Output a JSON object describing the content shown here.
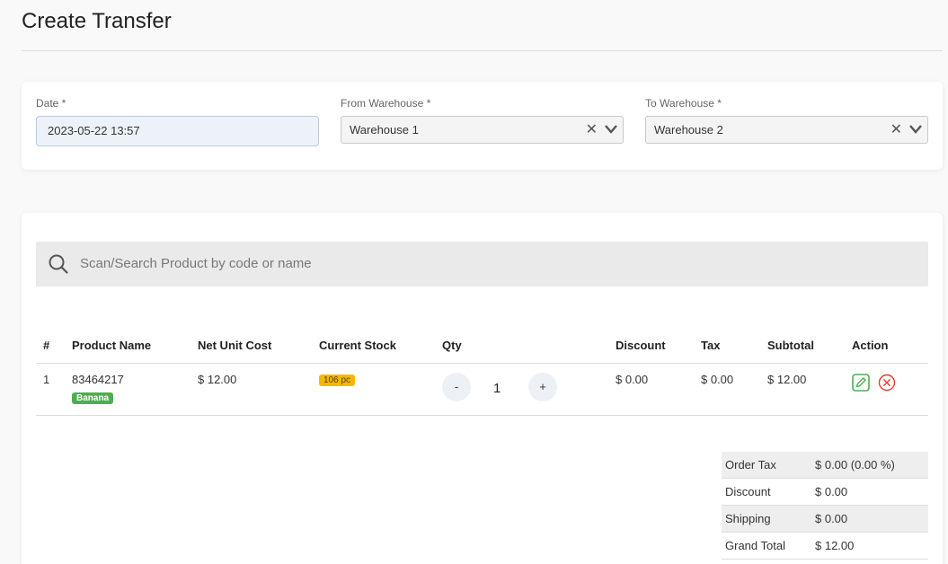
{
  "header": {
    "title": "Create Transfer"
  },
  "form": {
    "date_label": "Date *",
    "date_value": "2023-05-22 13:57",
    "from_label": "From Warehouse *",
    "from_value": "Warehouse 1",
    "to_label": "To Warehouse *",
    "to_value": "Warehouse 2",
    "clear_symbol": "✕"
  },
  "search": {
    "placeholder": "Scan/Search Product by code or name"
  },
  "table": {
    "columns": [
      "#",
      "Product Name",
      "Net Unit Cost",
      "Current Stock",
      "Qty",
      "Discount",
      "Tax",
      "Subtotal",
      "Action"
    ],
    "rows": [
      {
        "index": "1",
        "code": "83464217",
        "name_badge": "Banana",
        "net_unit_cost": "$ 12.00",
        "current_stock": "106 pc",
        "qty_minus": "-",
        "qty": "1",
        "qty_plus": "+",
        "discount": "$ 0.00",
        "tax": "$ 0.00",
        "subtotal": "$ 12.00"
      }
    ]
  },
  "summary": {
    "rows": [
      {
        "label": "Order Tax",
        "value": "$ 0.00 (0.00 %)"
      },
      {
        "label": "Discount",
        "value": "$ 0.00"
      },
      {
        "label": "Shipping",
        "value": "$ 0.00"
      },
      {
        "label": "Grand Total",
        "value": "$ 12.00"
      }
    ]
  },
  "colors": {
    "badge_green": "#4caf50",
    "badge_yellow": "#f5b800",
    "edit_icon": "#4caf50",
    "delete_icon": "#e53935"
  },
  "icons": {
    "search": "search-icon",
    "edit": "edit-icon",
    "delete": "delete-icon",
    "chevron": "chevron-down-icon",
    "clear": "clear-icon"
  }
}
